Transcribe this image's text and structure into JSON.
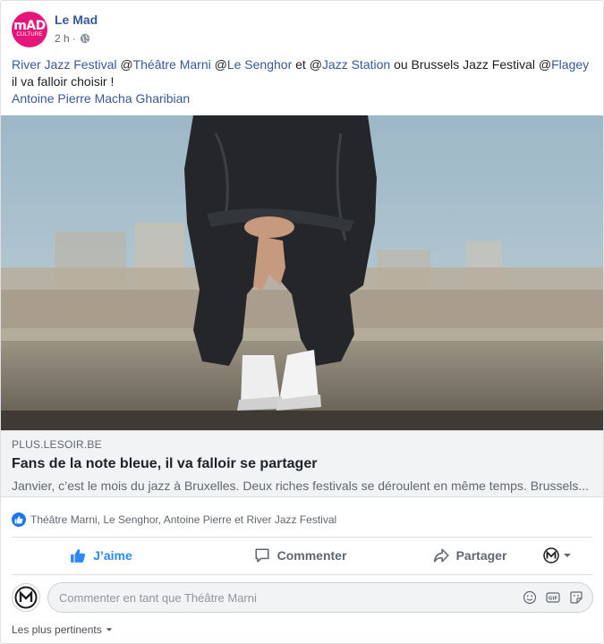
{
  "header": {
    "avatar_line1": "mAD",
    "avatar_line2": "CULTURE",
    "page_name": "Le Mad",
    "time": "2 h",
    "separator": "·"
  },
  "post": {
    "seg1": "River Jazz Festival",
    "seg2": "@",
    "seg3": "Théâtre Marni",
    "seg4": " @",
    "seg5": "Le Senghor",
    "seg6": " et @",
    "seg7": "Jazz Station",
    "seg8": " ou Brussels Jazz Festival @",
    "seg9": "Flagey",
    "line2": "il va falloir choisir !",
    "line3": "Antoine Pierre Macha Gharibian"
  },
  "link_preview": {
    "domain": "PLUS.LESOIR.BE",
    "title": "Fans de la note bleue, il va falloir se partager",
    "description": "Janvier, c’est le mois du jazz à Bruxelles. Deux riches festivals se déroulent en même temps. Brussels..."
  },
  "reactions": {
    "text": "Théâtre Marni, Le Senghor, Antoine Pierre et River Jazz Festival"
  },
  "actions": {
    "like": "J’aime",
    "comment": "Commenter",
    "share": "Partager"
  },
  "comment_box": {
    "placeholder": "Commenter en tant que Théâtre Marni"
  },
  "sort": {
    "label": "Les plus pertinents"
  },
  "colors": {
    "link": "#385898",
    "accent": "#2d88ff",
    "brand_avatar": "#e6157a"
  },
  "icons": [
    "globe-icon",
    "like-icon",
    "comment-icon",
    "share-icon",
    "emoji-icon",
    "gif-icon",
    "sticker-icon",
    "chevron-down-icon"
  ]
}
